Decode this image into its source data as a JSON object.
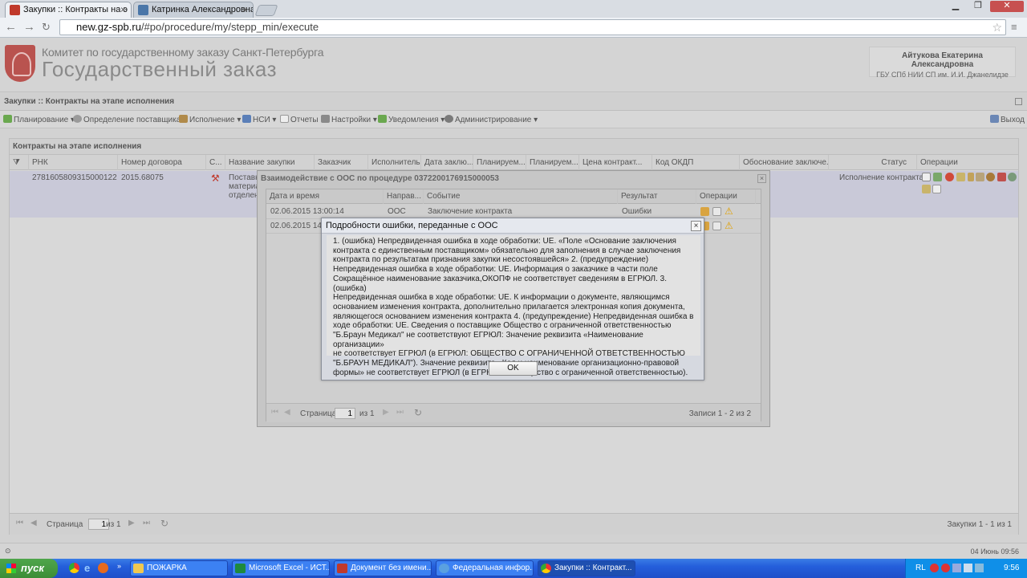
{
  "browser": {
    "tabs": [
      {
        "title": "Закупки :: Контракты на э",
        "active": true
      },
      {
        "title": "Катринка Александровна",
        "active": false
      }
    ],
    "url_host": "new.gz-spb.ru",
    "url_path": "/#po/procedure/my/stepp_min/execute"
  },
  "header": {
    "org_line1": "Комитет по государственному заказу Санкт-Петербурга",
    "org_line2": "Государственный заказ",
    "user_name": "Айтукова Екатерина Александровна",
    "user_org": "ГБУ СПб НИИ СП им. И.И. Джанелидзе"
  },
  "crumb": "Закупки :: Контракты на этапе исполнения",
  "menu": {
    "items": [
      "Планирование",
      "Определение поставщика",
      "Исполнение",
      "НСИ",
      "Отчеты",
      "Настройки",
      "Уведомления",
      "Администрирование"
    ],
    "exit": "Выход"
  },
  "grid": {
    "title": "Контракты на этапе исполнения",
    "columns": [
      "РНК",
      "Номер договора",
      "С...",
      "Название закупки",
      "Заказчик",
      "Исполнитель",
      "Дата заклю...",
      "Планируем...",
      "Планируем...",
      "Цена контракт...",
      "Код ОКДП",
      "Обоснование заключе...",
      "Статус",
      "Операции"
    ],
    "row": {
      "rnk": "2781605809315000122",
      "contract_no": "2015.68075",
      "name_lines": [
        "Поставк",
        "материа",
        "отделен"
      ],
      "status": "Исполнение контракта"
    },
    "pager": {
      "page_label": "Страница",
      "page": "1",
      "of": "из 1",
      "records": "Закупки 1 - 1 из 1"
    }
  },
  "statusbar": {
    "datetime": "04 Июнь 09:56"
  },
  "dialog_oos": {
    "title": "Взаимодействие с ООС по процедуре 0372200176915000053",
    "columns": [
      "Дата и время",
      "Направ...",
      "Событие",
      "Результат",
      "Операции"
    ],
    "rows": [
      {
        "datetime": "02.06.2015 13:00:14",
        "direction": "ООС",
        "event": "Заключение контракта",
        "result": "Ошибки"
      },
      {
        "datetime": "02.06.2015 14:48",
        "direction": "",
        "event": "",
        "result": ""
      }
    ],
    "pager": {
      "page_label": "Страница",
      "page": "1",
      "of": "из 1",
      "records": "Записи 1 - 2 из 2"
    }
  },
  "dialog_error": {
    "title": "Подробности ошибки, переданные с ООС",
    "lines": [
      "1. (ошибка) Непредвиденная ошибка в ходе обработки: UE. «Поле «Основание заключения",
      "контракта с единственным поставщиком» обязательно для заполнения в случае заключения",
      "контракта по результатам признания закупки несостоявшейся» 2. (предупреждение)",
      "Непредвиденная ошибка в ходе обработки: UE. Информация о заказчике в части поле",
      "Сокращённое наименование заказчика,ОКОПФ не соответствует сведениям в ЕГРЮЛ. 3. (ошибка)",
      "Непредвиденная ошибка в ходе обработки: UE. К информации о документе, являющимся",
      "основанием изменения контракта, дополнительно прилагается электронная копия документа,",
      "являющегося основанием изменения контракта 4. (предупреждение) Непредвиденная ошибка в",
      "ходе обработки: UE. Сведения о поставщике Общество с ограниченной ответственностью",
      "\"Б.Браун Медикал\" не соответствуют ЕГРЮЛ: Значение реквизита «Наименование организации»",
      "не соответствует ЕГРЮЛ (в ЕГРЮЛ: ОБЩЕСТВО С ОГРАНИЧЕННОЙ ОТВЕТСТВЕННОСТЬЮ",
      "\"Б.БРАУН МЕДИКАЛ\"). Значение реквизита «Код и наименование организационно-правовой",
      "формы» не соответствует ЕГРЮЛ (в ЕГРЮЛ: 65 Общество с ограниченной ответственностью)."
    ],
    "ok": "OK"
  },
  "taskbar": {
    "start": "пуск",
    "items": [
      "ПОЖАРКА",
      "Microsoft Excel - ИСТ...",
      "Документ без имени...",
      "Федеральная инфор...",
      "Закупки :: Контракт..."
    ],
    "lang": "RL",
    "clock": "9:56"
  }
}
